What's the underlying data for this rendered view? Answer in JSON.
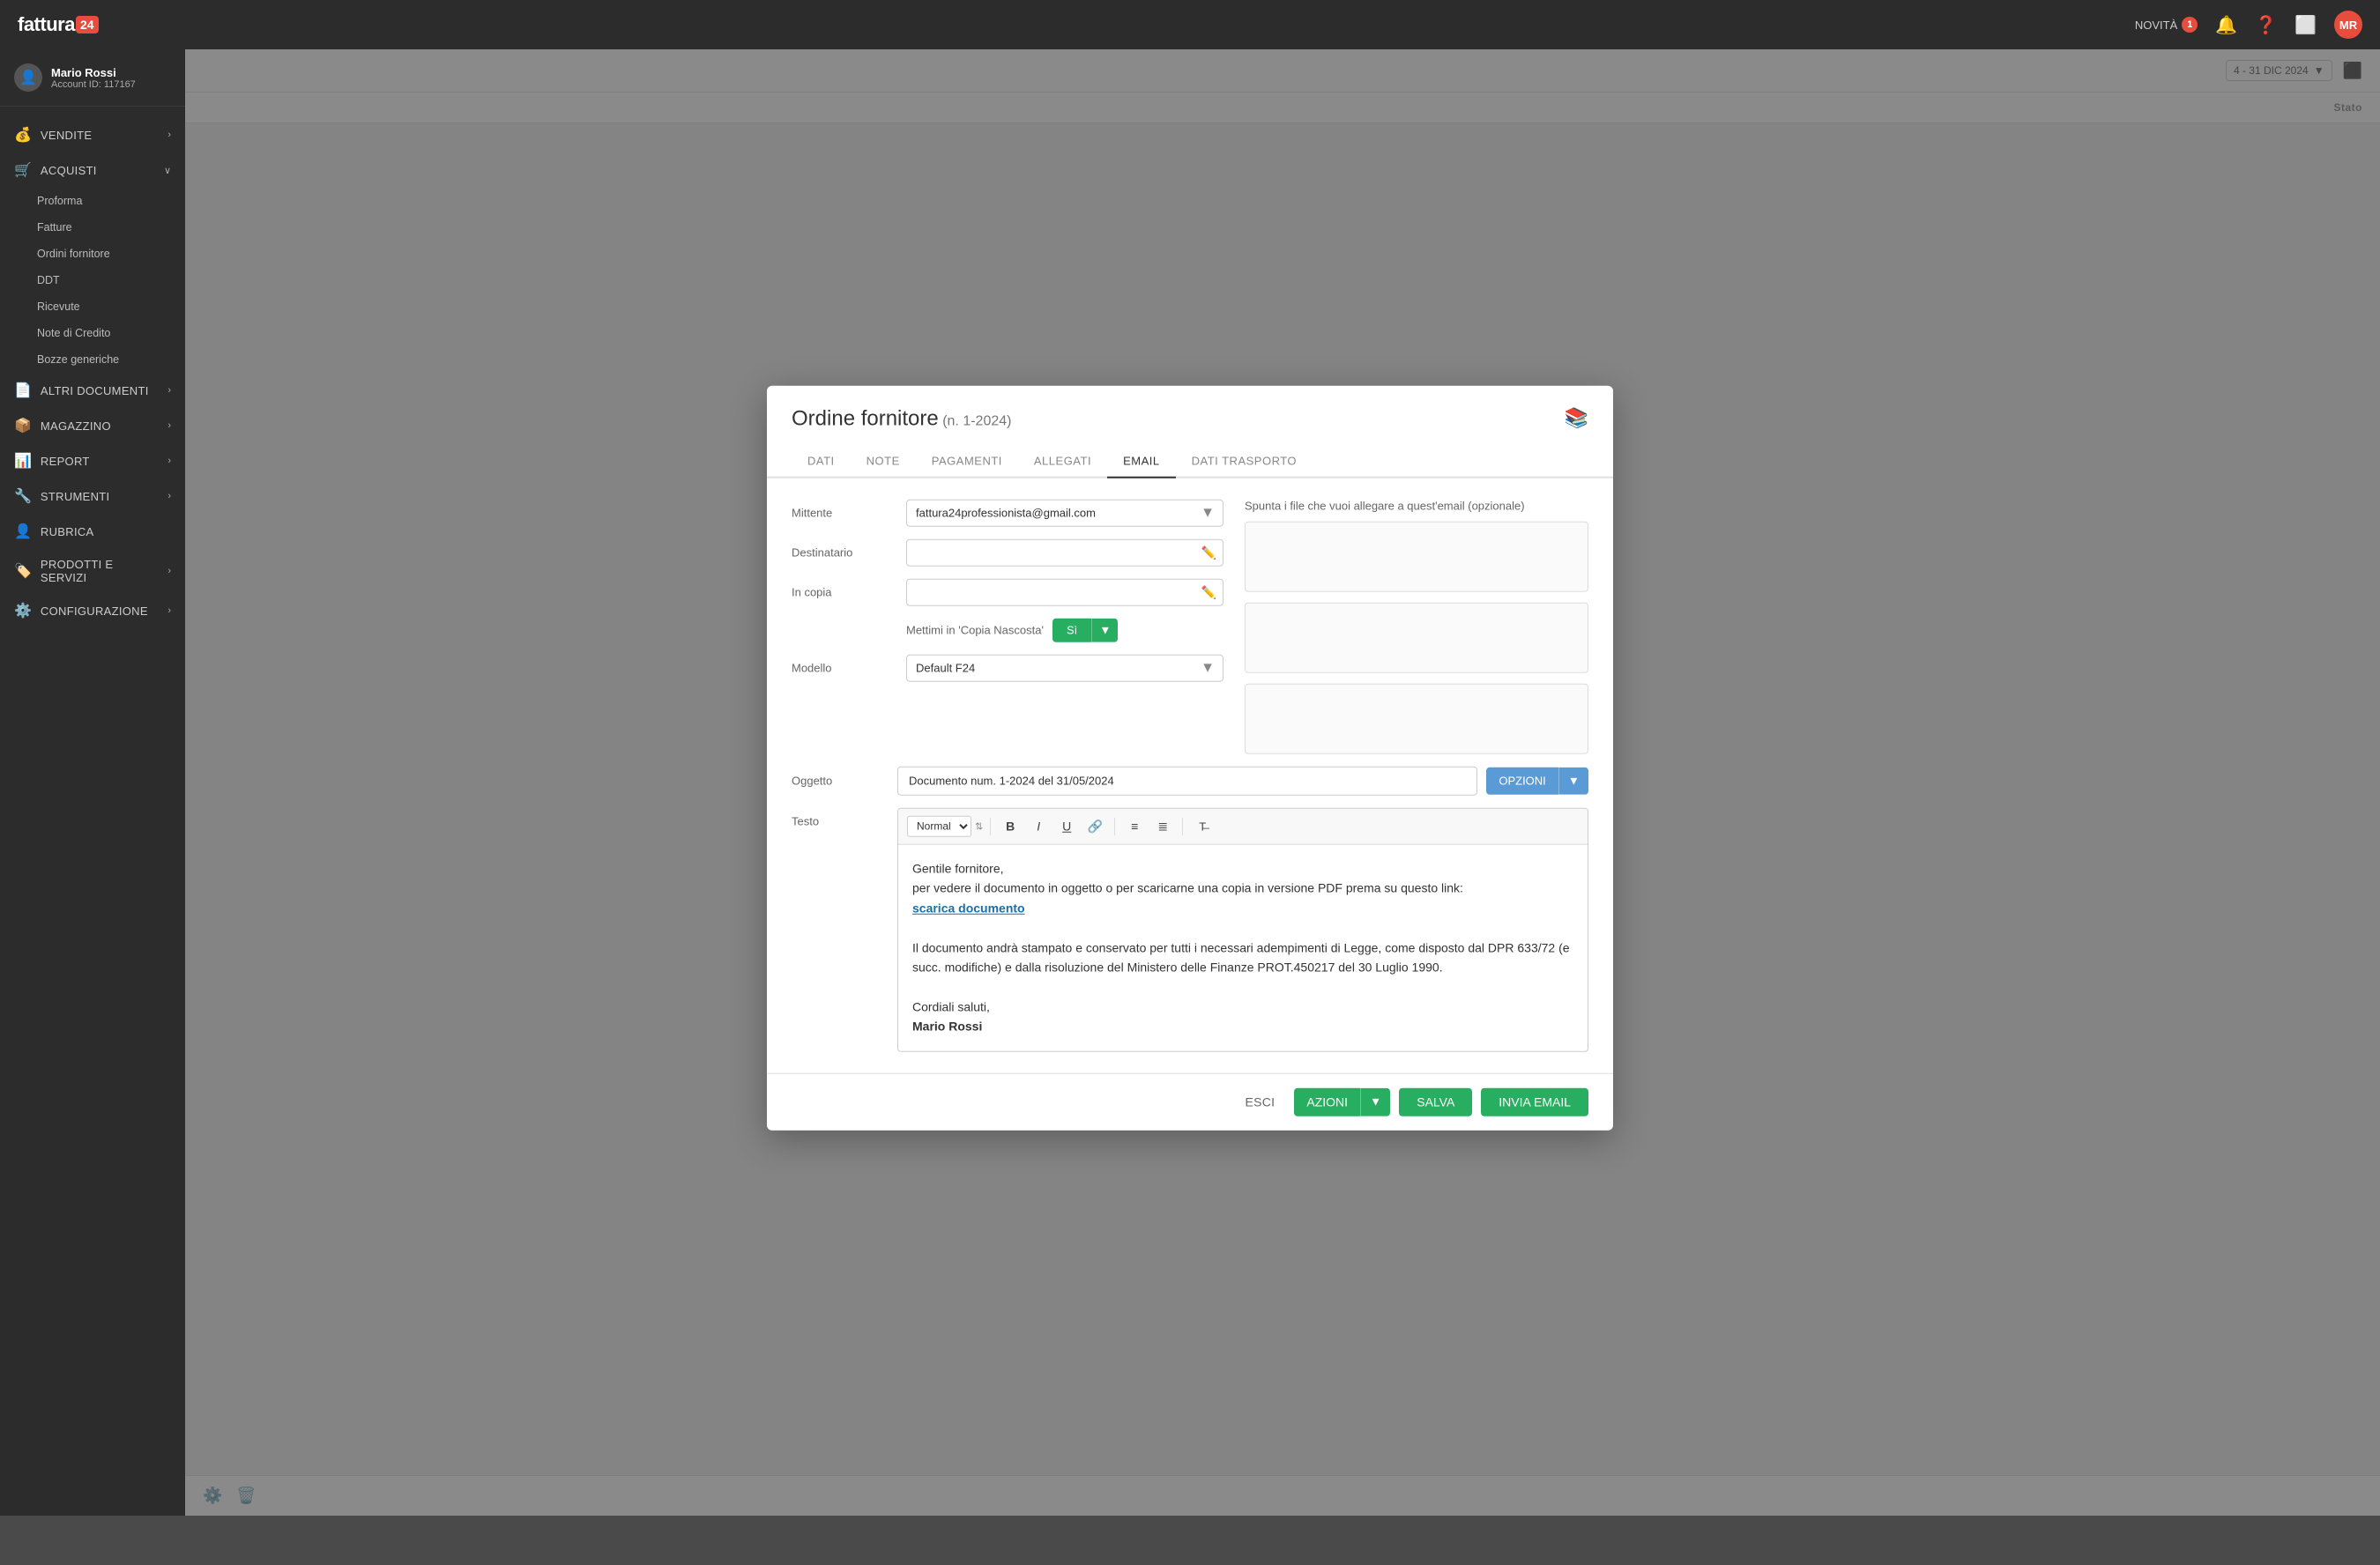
{
  "app": {
    "name": "fattura",
    "name_suffix": "24",
    "topbar": {
      "novita_label": "NOVITÀ",
      "novita_count": "1",
      "user_initials": "MR"
    }
  },
  "sidebar": {
    "user": {
      "name": "Mario Rossi",
      "account_label": "Account ID: 117167"
    },
    "sections": [
      {
        "id": "vendite",
        "label": "VENDITE",
        "icon": "💰",
        "has_arrow": true
      },
      {
        "id": "acquisti",
        "label": "ACQUISTI",
        "icon": "🛒",
        "has_arrow": true,
        "expanded": true
      },
      {
        "id": "altri_documenti",
        "label": "ALTRI DOCUMENTI",
        "icon": "📄",
        "has_arrow": true
      },
      {
        "id": "magazzino",
        "label": "MAGAZZINO",
        "icon": "📦",
        "has_arrow": true
      },
      {
        "id": "report",
        "label": "REPORT",
        "icon": "📊",
        "has_arrow": true
      },
      {
        "id": "strumenti",
        "label": "STRUMENTI",
        "icon": "🔧",
        "has_arrow": true
      },
      {
        "id": "rubrica",
        "label": "RUBRICA",
        "icon": "👤"
      },
      {
        "id": "prodotti",
        "label": "PRODOTTI E SERVIZI",
        "icon": "🏷️",
        "has_arrow": true
      },
      {
        "id": "configurazione",
        "label": "CONFIGURAZIONE",
        "icon": "⚙️",
        "has_arrow": true
      }
    ],
    "acquisti_sub": [
      "Proforma",
      "Fatture",
      "Ordini fornitore",
      "DDT",
      "Ricevute",
      "Note di Credito",
      "Bozze generiche"
    ]
  },
  "bg_header": {
    "date_range": "4 - 31 DIC 2024",
    "stato_label": "Stato"
  },
  "modal": {
    "title": "Ordine fornitore",
    "doc_number": "(n. 1-2024)",
    "tabs": [
      {
        "id": "dati",
        "label": "DATI"
      },
      {
        "id": "note",
        "label": "NOTE"
      },
      {
        "id": "pagamenti",
        "label": "PAGAMENTI"
      },
      {
        "id": "allegati",
        "label": "ALLEGATI"
      },
      {
        "id": "email",
        "label": "EMAIL",
        "active": true
      },
      {
        "id": "dati_trasporto",
        "label": "DATI TRASPORTO"
      }
    ],
    "email": {
      "mittente_label": "Mittente",
      "mittente_value": "fattura24professionista@gmail.com",
      "destinatario_label": "Destinatario",
      "destinatario_placeholder": "",
      "in_copia_label": "In copia",
      "in_copia_placeholder": "",
      "bcc_label": "Mettimi in 'Copia Nascosta'",
      "bcc_value": "Sì",
      "modello_label": "Modello",
      "modello_value": "Default F24",
      "oggetto_label": "Oggetto",
      "oggetto_value": "Documento num. 1-2024 del 31/05/2024",
      "testo_label": "Testo",
      "attachments_hint": "Spunta i file che vuoi allegare a quest'email (opzionale)",
      "editor_format": "Normal",
      "editor_body_line1": "Gentile fornitore,",
      "editor_body_line2": "per vedere il documento in oggetto o per scaricarne una copia in versione PDF prema su questo link:",
      "editor_link": "scarica documento",
      "editor_body_line3": "Il documento andrà stampato e conservato per tutti i necessari adempimenti di Legge, come disposto dal DPR 633/72 (e succ. modifiche) e dalla risoluzione del Ministero delle Finanze PROT.450217 del 30 Luglio 1990.",
      "editor_closing": "Cordiali saluti,",
      "editor_signature": "Mario Rossi"
    },
    "footer": {
      "esci": "ESCI",
      "azioni": "AZIONI",
      "salva": "SALVA",
      "invia": "INVIA EMAIL"
    }
  }
}
